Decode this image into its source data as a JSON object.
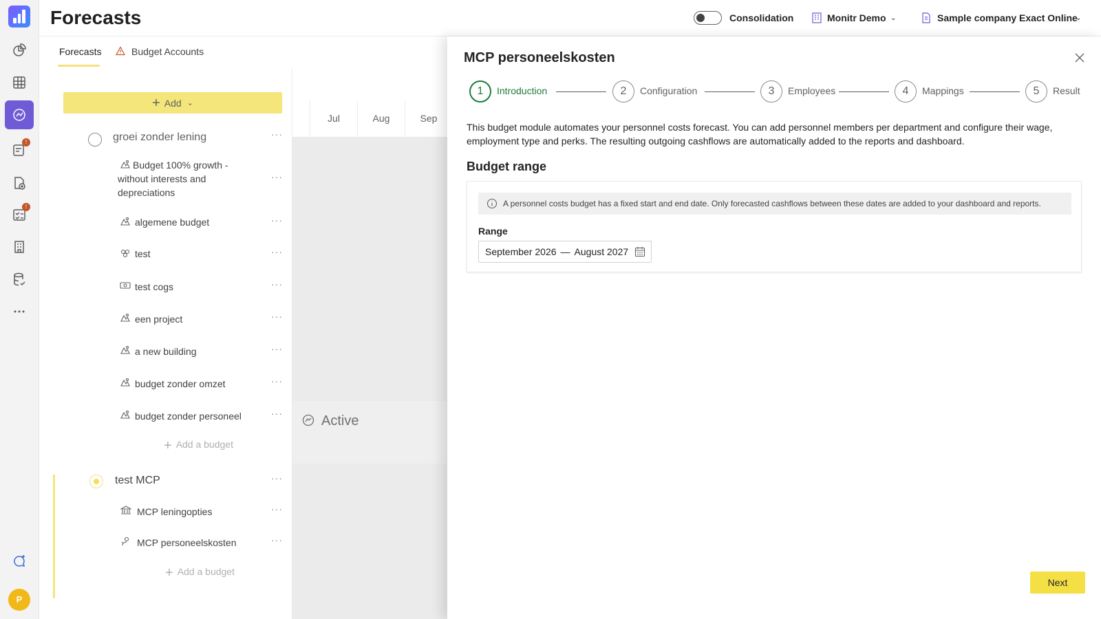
{
  "app": {
    "page_title": "Forecasts",
    "avatar_initial": "P"
  },
  "topbar": {
    "consolidation_label": "Consolidation",
    "consolidation_on": false,
    "org_name": "Monitr Demo",
    "company_name": "Sample company Exact Online"
  },
  "tabs": [
    {
      "label": "Forecasts",
      "active": true
    },
    {
      "label": "Budget Accounts",
      "warning": true
    }
  ],
  "list": {
    "add_label": "Add",
    "group1": {
      "title": "groei zonder lening",
      "budgets": [
        {
          "label": "Budget 100% growth - without interests and depreciations",
          "icon": "scenario-icon"
        },
        {
          "label": "algemene budget",
          "icon": "scenario-icon"
        },
        {
          "label": "test",
          "icon": "group-icon"
        },
        {
          "label": "test cogs",
          "icon": "money-icon"
        },
        {
          "label": "een project",
          "icon": "scenario-icon"
        },
        {
          "label": "a new building",
          "icon": "scenario-icon"
        },
        {
          "label": "budget zonder omzet",
          "icon": "scenario-icon"
        },
        {
          "label": "budget zonder personeel",
          "icon": "scenario-icon"
        }
      ],
      "add_budget_label": "Add a budget"
    },
    "group2": {
      "title": "test MCP",
      "budgets": [
        {
          "label": "MCP leningopties",
          "icon": "bank-icon"
        },
        {
          "label": "MCP personeelskosten",
          "icon": "person-icon"
        }
      ],
      "add_budget_label": "Add a budget"
    }
  },
  "timeline": {
    "months": [
      "Jul",
      "Aug",
      "Sep"
    ],
    "status_label": "Active"
  },
  "drawer": {
    "title": "MCP personeelskosten",
    "steps": [
      {
        "number": "1",
        "label": "Introduction",
        "current": true
      },
      {
        "number": "2",
        "label": "Configuration"
      },
      {
        "number": "3",
        "label": "Employees"
      },
      {
        "number": "4",
        "label": "Mappings"
      },
      {
        "number": "5",
        "label": "Result"
      }
    ],
    "intro_text": "This budget module automates your personnel costs forecast. You can add personnel members per department and configure their wage, employment type and perks. The resulting outgoing cashflows are automatically added to the reports and dashboard.",
    "section_title": "Budget range",
    "info_text": "A personnel costs budget has a fixed start and end date. Only forecasted cashflows between these dates are added to your dashboard and reports.",
    "range_label": "Range",
    "range_start": "September 2026",
    "range_separator": "—",
    "range_end": "August 2027",
    "next_label": "Next"
  },
  "colors": {
    "accent_yellow": "#f4e67a",
    "active_rail": "#6f5bd6",
    "step_current": "#1f7a3a",
    "badge": "#c4542a"
  }
}
